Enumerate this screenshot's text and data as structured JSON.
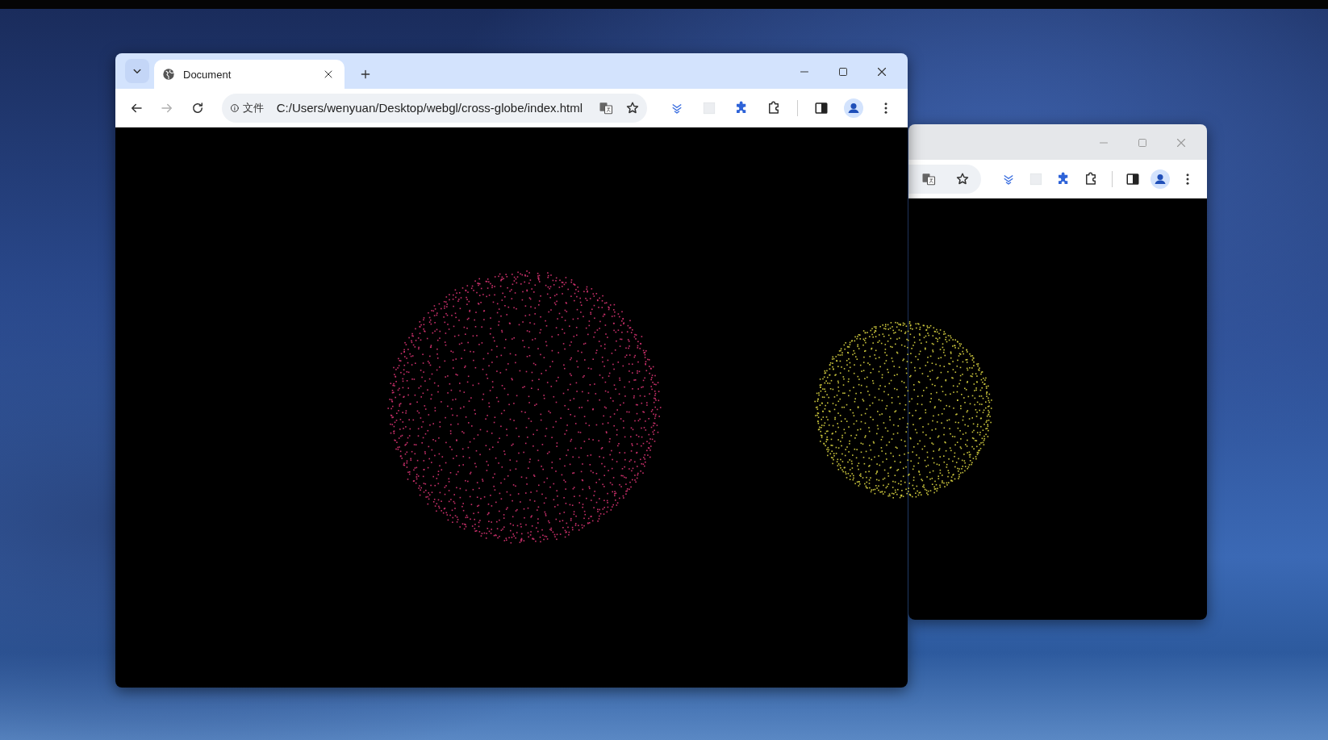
{
  "windows": [
    {
      "kind": "back"
    },
    {
      "kind": "front",
      "tabs": [
        {
          "title": "Document",
          "selected": true
        }
      ],
      "nav": [
        {
          "kind": "back",
          "disabled": false
        },
        {
          "kind": "forward",
          "disabled": true
        },
        {
          "kind": "reload",
          "disabled": false
        }
      ],
      "address": {
        "scheme_label": "文件",
        "url": "C:/Users/wenyuan/Desktop/webgl/cross-globe/index.html"
      }
    }
  ],
  "scene": {
    "globes": [
      {
        "color": "#c8306a"
      },
      {
        "color": "#c9c43c"
      }
    ]
  }
}
